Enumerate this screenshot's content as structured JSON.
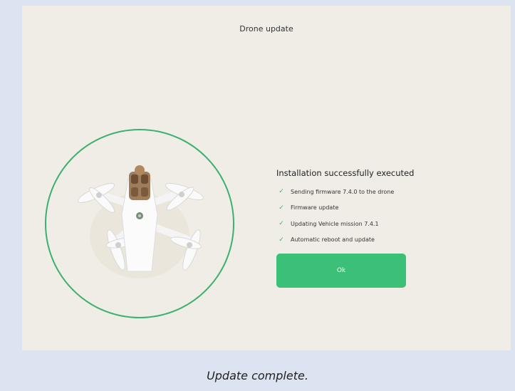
{
  "screen": {
    "title": "Drone update"
  },
  "status": {
    "heading": "Installation successfully executed",
    "steps": [
      {
        "label": "Sending firmware 7.4.0 to the drone",
        "done": true
      },
      {
        "label": "Firmware update",
        "done": true
      },
      {
        "label": "Updating Vehicle mission 7.4.1",
        "done": true
      },
      {
        "label": "Automatic reboot and update",
        "done": true
      }
    ]
  },
  "actions": {
    "ok_label": "Ok"
  },
  "caption": "Update complete.",
  "colors": {
    "accent": "#3cc078",
    "ring": "#3bb070",
    "screen_bg": "#f0ede6",
    "frame_bg": "#dce4f2"
  },
  "icons": {
    "check": "check-icon",
    "drone": "drone-image"
  }
}
